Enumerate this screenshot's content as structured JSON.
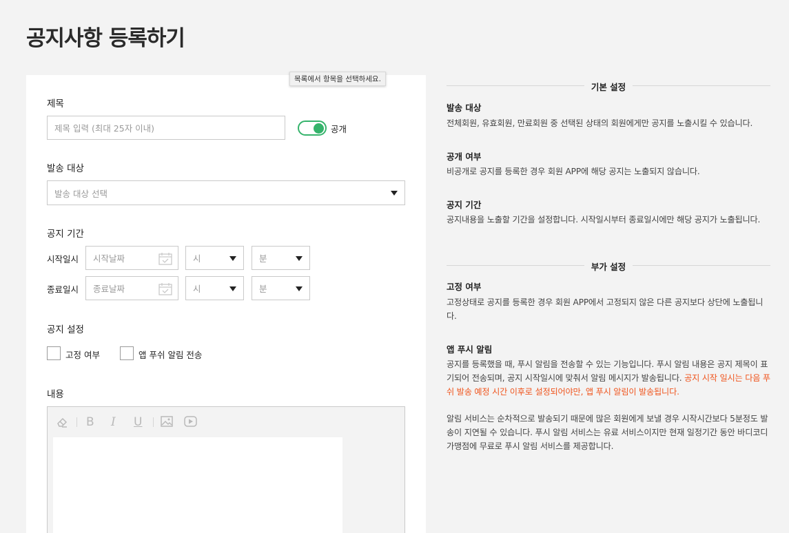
{
  "page_title": "공지사항 등록하기",
  "tooltip": "목록에서 항목을 선택하세요.",
  "form": {
    "title_label": "제목",
    "title_placeholder": "제목 입력 (최대 25자 이내)",
    "public_toggle_label": "공개",
    "public_toggle_on": true,
    "target_label": "발송 대상",
    "target_placeholder": "발송 대상 선택",
    "period_label": "공지 기간",
    "start_label": "시작일시",
    "start_date_placeholder": "시작날짜",
    "end_label": "종료일시",
    "end_date_placeholder": "종료날짜",
    "hour_placeholder": "시",
    "minute_placeholder": "분",
    "settings_label": "공지 설정",
    "pin_label": "고정 여부",
    "push_label": "앱 푸쉬 알림 전송",
    "content_label": "내용",
    "editor_tools": [
      "eraser-icon",
      "bold-icon",
      "italic-icon",
      "underline-icon",
      "image-icon",
      "video-icon"
    ]
  },
  "side": {
    "basic_heading": "기본 설정",
    "target_title": "발송 대상",
    "target_desc": "전체회원, 유효회원, 만료회원 중 선택된 상태의 회원에게만 공지를 노출시킬 수 있습니다.",
    "public_title": "공개 여부",
    "public_desc": "비공개로 공지를 등록한 경우 회원 APP에 해당 공지는 노출되지 않습니다.",
    "period_title": "공지 기간",
    "period_desc": "공지내용을 노출할 기간을 설정합니다. 시작일시부터 종료일시에만 해당 공지가 노출됩니다.",
    "extra_heading": "부가 설정",
    "pin_title": "고정 여부",
    "pin_desc": "고정상태로 공지를 등록한 경우 회원 APP에서 고정되지 않은 다른 공지보다 상단에 노출됩니다.",
    "push_title": "앱 푸시 알림",
    "push_desc": "공지를 등록했을 때, 푸시 알림을 전송할 수 있는 기능입니다. 푸시 알림 내용은 공지 제목이 표기되어 전송되며, 공지 시작일시에 맞춰서 알림 메시지가 발송됩니다. ",
    "push_desc_accent": "공지 시작 일시는 다음 푸쉬 발송 예정 시간 이후로 설정되어야만, 앱 푸시 알림이 발송됩니다.",
    "push_note": "알림 서비스는 순차적으로 발송되기 때문에 많은 회원에게 보낼 경우 시작시간보다 5분정도 발송이 지연될 수 있습니다. 푸시 알림 서비스는 유료 서비스이지만 현재 일정기간 동안 바디코디 가맹점에 무료로 푸시 알림 서비스를 제공합니다."
  },
  "colors": {
    "accent_green": "#35b36b",
    "accent_orange": "#f0561f"
  }
}
